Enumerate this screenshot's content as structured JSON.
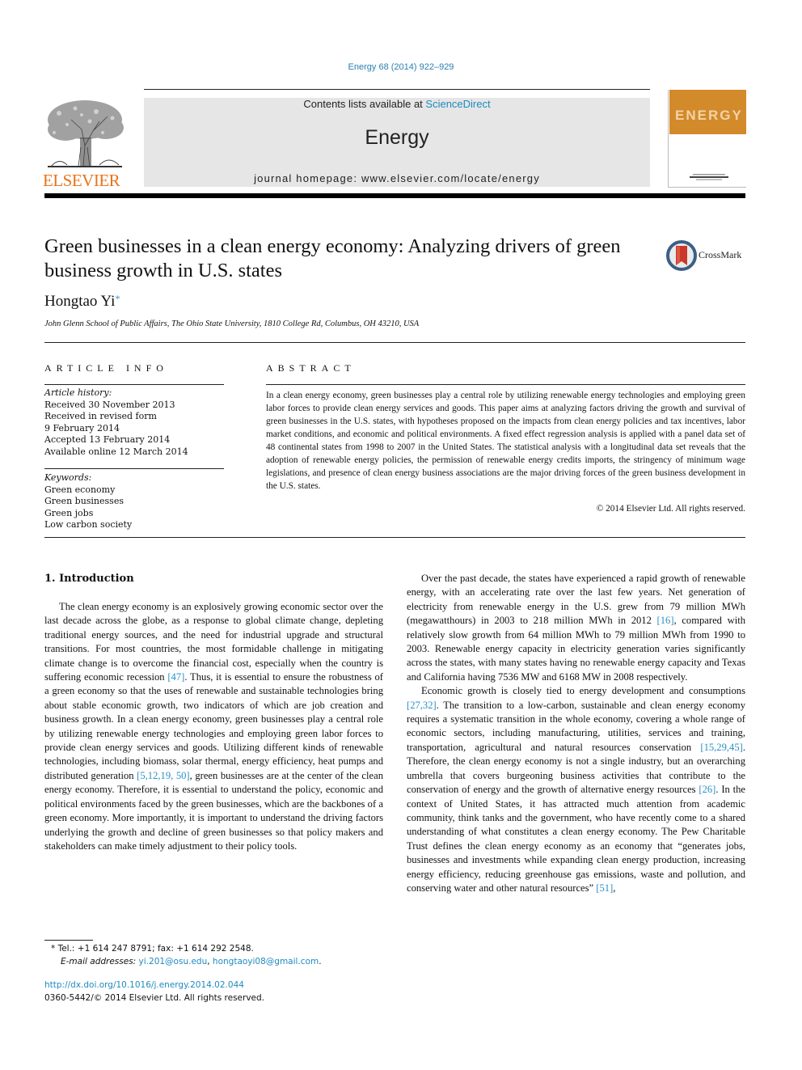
{
  "journal_citation": "Energy 68 (2014) 922–929",
  "header": {
    "publisher": "ELSEVIER",
    "contents_prefix": "Contents lists available at ",
    "contents_link": "ScienceDirect",
    "journal_name": "Energy",
    "homepage": "journal homepage: www.elsevier.com/locate/energy",
    "cover_title": "ENERGY",
    "colors": {
      "publisher_orange": "#e8731a",
      "cover_orange": "#d38a2b",
      "link_blue": "#2a8fc4",
      "band_gray": "#e6e6e6"
    }
  },
  "article": {
    "title": "Green businesses in a clean energy economy: Analyzing drivers of green business growth in U.S. states",
    "crossmark_label": "CrossMark",
    "author": "Hongtao Yi",
    "author_mark": "*",
    "affiliation": "John Glenn School of Public Affairs, The Ohio State University, 1810 College Rd, Columbus, OH 43210, USA"
  },
  "article_info": {
    "heading": "ARTICLE INFO",
    "history_label": "Article history:",
    "history": [
      "Received 30 November 2013",
      "Received in revised form",
      "9 February 2014",
      "Accepted 13 February 2014",
      "Available online 12 March 2014"
    ],
    "keywords_label": "Keywords:",
    "keywords": [
      "Green economy",
      "Green businesses",
      "Green jobs",
      "Low carbon society"
    ]
  },
  "abstract": {
    "heading": "ABSTRACT",
    "text": "In a clean energy economy, green businesses play a central role by utilizing renewable energy technologies and employing green labor forces to provide clean energy services and goods. This paper aims at analyzing factors driving the growth and survival of green businesses in the U.S. states, with hypotheses proposed on the impacts from clean energy policies and tax incentives, labor market conditions, and economic and political environments. A fixed effect regression analysis is applied with a panel data set of 48 continental states from 1998 to 2007 in the United States. The statistical analysis with a longitudinal data set reveals that the adoption of renewable energy policies, the permission of renewable energy credits imports, the stringency of minimum wage legislations, and presence of clean energy business associations are the major driving forces of the green business development in the U.S. states.",
    "copyright": "© 2014 Elsevier Ltd. All rights reserved."
  },
  "introduction": {
    "heading": "1.  Introduction",
    "left_paragraph": [
      "The clean energy economy is an explosively growing economic sector over the last decade across the globe, as a response to global climate change, depleting traditional energy sources, and the need for industrial upgrade and structural transitions. For most countries, the most formidable challenge in mitigating climate change is to overcome the financial cost, especially when the country is suffering economic recession ",
      "[47]",
      ". Thus, it is essential to ensure the robustness of a green economy so that the uses of renewable and sustainable technologies bring about stable economic growth, two indicators of which are job creation and business growth. In a clean energy economy, green businesses play a central role by utilizing renewable energy technologies and employing green labor forces to provide clean energy services and goods. Utilizing different kinds of renewable technologies, including biomass, solar thermal, energy efficiency, heat pumps and distributed generation ",
      "[5,12,19, 50]",
      ", green businesses are at the center of the clean energy economy. Therefore, it is essential to understand the policy, economic and political environments faced by the green businesses, which are the backbones of a green economy. More importantly, it is important to understand the driving factors underlying the growth and decline of green businesses so that policy makers and stakeholders can make timely adjustment to their policy tools."
    ],
    "right_paragraph_1": [
      "Over the past decade, the states have experienced a rapid growth of renewable energy, with an accelerating rate over the last few years. Net generation of electricity from renewable energy in the U.S. grew from 79 million MWh (megawatthours) in 2003 to 218 million MWh in 2012 ",
      "[16]",
      ", compared with relatively slow growth from 64 million MWh to 79 million MWh from 1990 to 2003. Renewable energy capacity in electricity generation varies significantly across the states, with many states having no renewable energy capacity and Texas and California having 7536 MW and 6168 MW in 2008 respectively."
    ],
    "right_paragraph_2": [
      "Economic growth is closely tied to energy development and consumptions ",
      "[27,32]",
      ". The transition to a low-carbon, sustainable and clean energy economy requires a systematic transition in the whole economy, covering a whole range of economic sectors, including manufacturing, utilities, services and training, transportation, agricultural and natural resources conservation ",
      "[15,29,45]",
      ". Therefore, the clean energy economy is not a single industry, but an overarching umbrella that covers burgeoning business activities that contribute to the conservation of energy and the growth of alternative energy resources ",
      "[26]",
      ". In the context of United States, it has attracted much attention from academic community, think tanks and the government, who have recently come to a shared understanding of what constitutes a clean energy economy. The Pew Charitable Trust defines the clean energy economy as an economy that “generates jobs, businesses and investments while expanding clean energy production, increasing energy efficiency, reducing greenhouse gas emissions, waste and pollution, and conserving water and other natural resources” ",
      "[51]",
      ","
    ]
  },
  "footnote": {
    "contact": "* Tel.: +1 614 247 8791; fax: +1 614 292 2548.",
    "email_label": "E-mail addresses: ",
    "email_1": "yi.201@osu.edu",
    "email_sep": ", ",
    "email_2": "hongtaoyi08@gmail.com",
    "email_end": "."
  },
  "doi": "http://dx.doi.org/10.1016/j.energy.2014.02.044",
  "issn_copyright": "0360-5442/© 2014 Elsevier Ltd. All rights reserved."
}
